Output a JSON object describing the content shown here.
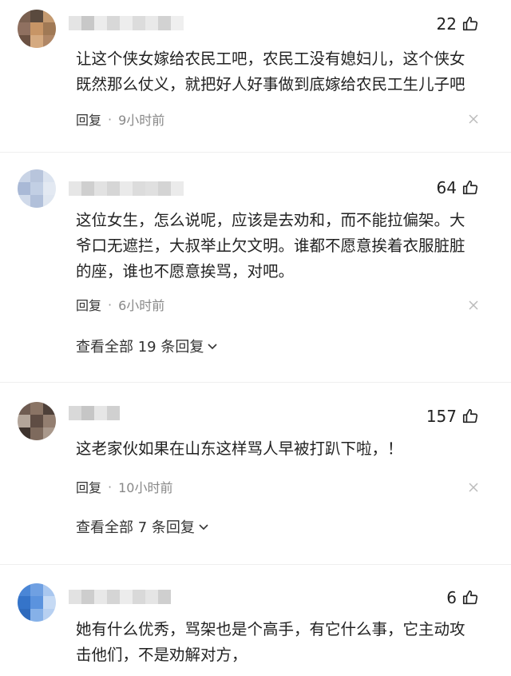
{
  "comments": [
    {
      "likes": "22",
      "lines": [
        "让这个侠女嫁给农民工吧，农民工没有媳妇儿，这个侠女",
        "既然那么仗义，就把好人好事做到底嫁给农民工生儿子吧"
      ],
      "reply_label": "回复",
      "dot": "·",
      "time": "9小时前"
    },
    {
      "likes": "64",
      "lines": [
        "这位女生，怎么说呢，应该是去劝和，而不能拉偏架。大",
        "爷口无遮拦，大叔举止欠文明。谁都不愿意挨着衣服脏脏",
        "的座，谁也不愿意挨骂，对吧。"
      ],
      "reply_label": "回复",
      "dot": "·",
      "time": "6小时前",
      "more": "查看全部 19 条回复"
    },
    {
      "likes": "157",
      "lines": [
        "这老家伙如果在山东这样骂人早被打趴下啦，！"
      ],
      "reply_label": "回复",
      "dot": "·",
      "time": "10小时前",
      "more": "查看全部 7 条回复"
    },
    {
      "likes": "6",
      "lines": [
        "她有什么优秀，骂架也是个高手，有它什么事，它主动攻",
        "击他们，不是劝解对方，"
      ]
    }
  ],
  "icons": {
    "like": "thumbs-up-icon",
    "close": "close-icon",
    "expand": "chevron-down-icon"
  }
}
